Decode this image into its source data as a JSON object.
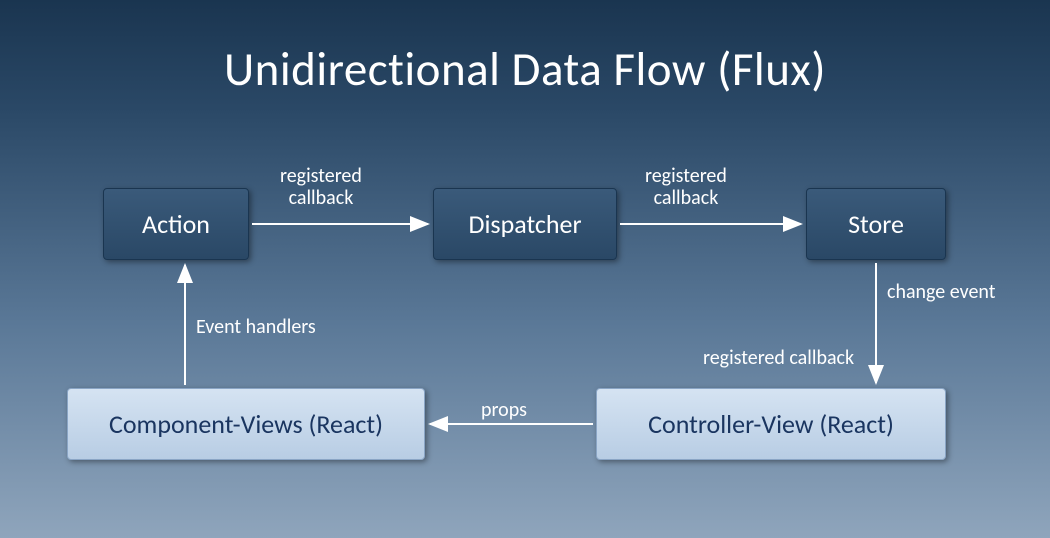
{
  "title": "Unidirectional Data Flow (Flux)",
  "nodes": {
    "action": "Action",
    "dispatcher": "Dispatcher",
    "store": "Store",
    "componentViews": "Component-Views (React)",
    "controllerView": "Controller-View (React)"
  },
  "edges": {
    "actionToDispatcher": "registered\ncallback",
    "dispatcherToStore": "registered\ncallback",
    "storeToControllerTop": "change event",
    "storeToControllerBottom": "registered callback",
    "controllerToComponent": "props",
    "componentToAction": "Event handlers"
  }
}
